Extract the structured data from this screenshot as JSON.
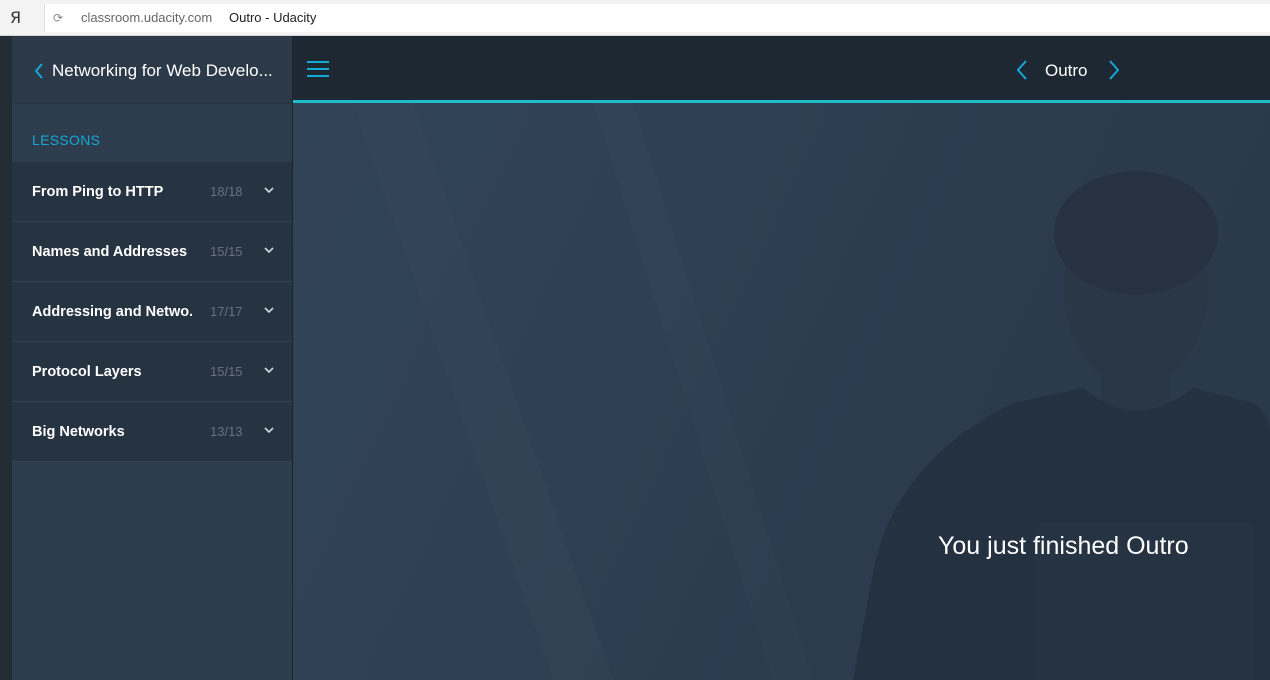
{
  "browser": {
    "logo_glyph": "Я",
    "reload_icon": "reload-icon",
    "url_domain": "classroom.udacity.com",
    "page_title": "Outro - Udacity"
  },
  "sidebar": {
    "course_title": "Networking for Web Develo...",
    "back_icon": "chevron-left-icon",
    "lessons_label": "LESSONS",
    "accent_color": "#15a7d8",
    "lessons": [
      {
        "title": "From Ping to HTTP",
        "count": "18/18"
      },
      {
        "title": "Names and Addresses",
        "count": "15/15"
      },
      {
        "title": "Addressing and Netwo...",
        "count": "17/17"
      },
      {
        "title": "Protocol Layers",
        "count": "15/15"
      },
      {
        "title": "Big Networks",
        "count": "13/13"
      }
    ]
  },
  "topbar": {
    "menu_icon": "hamburger-menu-icon",
    "current_title": "Outro",
    "accent_color": "#1fbdc7"
  },
  "main": {
    "finish_message": "You just finished Outro"
  }
}
